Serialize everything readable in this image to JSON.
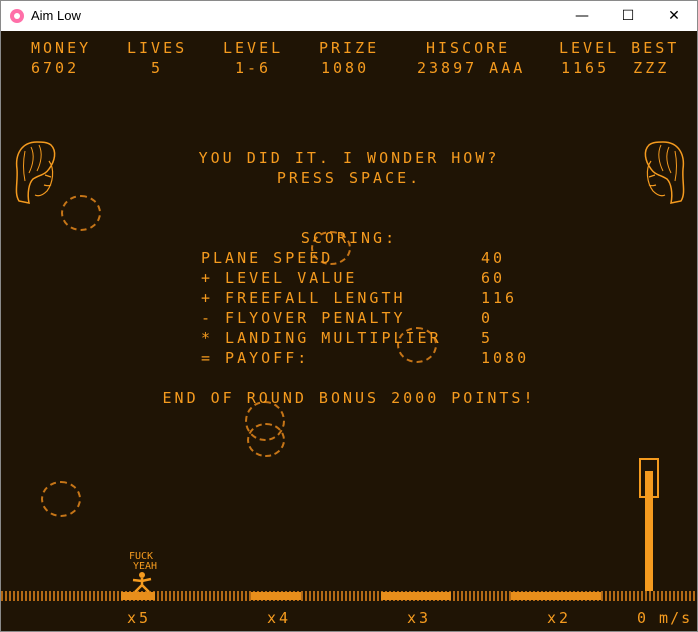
{
  "window": {
    "title": "Aim Low",
    "minimize": "—",
    "maximize": "☐",
    "close": "✕"
  },
  "hud": [
    {
      "label": "MONEY",
      "value": "6702"
    },
    {
      "label": "LIVES",
      "value": "5"
    },
    {
      "label": "LEVEL",
      "value": "1-6"
    },
    {
      "label": "PRIZE",
      "value": "1080"
    },
    {
      "label": "HISCORE",
      "value": "23897 AAA"
    },
    {
      "label": "LEVEL BEST",
      "value": "1165  ZZZ"
    }
  ],
  "message": {
    "line1": "YOU DID IT. I WONDER HOW?",
    "line2": "PRESS SPACE."
  },
  "scoring": {
    "title": "SCORING:",
    "rows": [
      {
        "label": "PLANE SPEED",
        "value": "40"
      },
      {
        "label": "+ LEVEL VALUE",
        "value": "60"
      },
      {
        "label": "+ FREEFALL LENGTH",
        "value": "116"
      },
      {
        "label": "- FLYOVER PENALTY",
        "value": "0"
      },
      {
        "label": "* LANDING MULTIPLIER",
        "value": "5"
      },
      {
        "label": "= PAYOFF:",
        "value": "1080"
      }
    ]
  },
  "bonus": "END OF ROUND BONUS 2000 POINTS!",
  "player_shout": {
    "line1": "FUCK",
    "line2": "YEAH"
  },
  "multipliers": [
    "x5",
    "x4",
    "x3",
    "x2"
  ],
  "speed": "0 m/s",
  "colors": {
    "background": "#1f1405",
    "text": "#f59b1f"
  }
}
